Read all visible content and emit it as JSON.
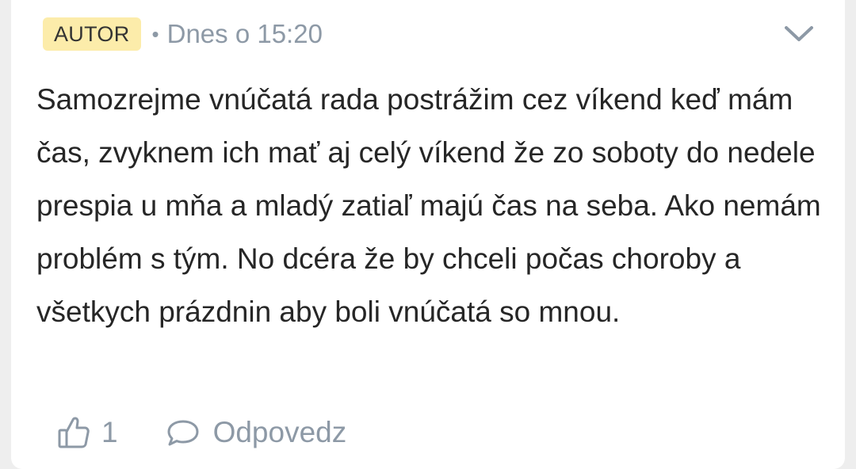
{
  "comment": {
    "author_badge": "AUTOR",
    "separator": "•",
    "timestamp": "Dnes o 15:20",
    "text": "Samozrejme vnúčatá rada postrážim cez víkend keď mám čas, zvyknem ich mať aj celý víkend že zo soboty do nedele prespia u mňa a mladý zatiaľ majú čas na seba. Ako nemám problém s tým. No dcéra že by chceli počas choroby a všetkych prázdnin aby boli vnúčatá so mnou.",
    "like_count": "1",
    "reply_label": "Odpovedz"
  },
  "icons": {
    "expand": "chevron-down-icon",
    "like": "thumbs-up-icon",
    "reply": "speech-bubble-icon"
  },
  "colors": {
    "badge_bg": "#fcecaa",
    "muted": "#8d99a6",
    "text": "#262626"
  }
}
